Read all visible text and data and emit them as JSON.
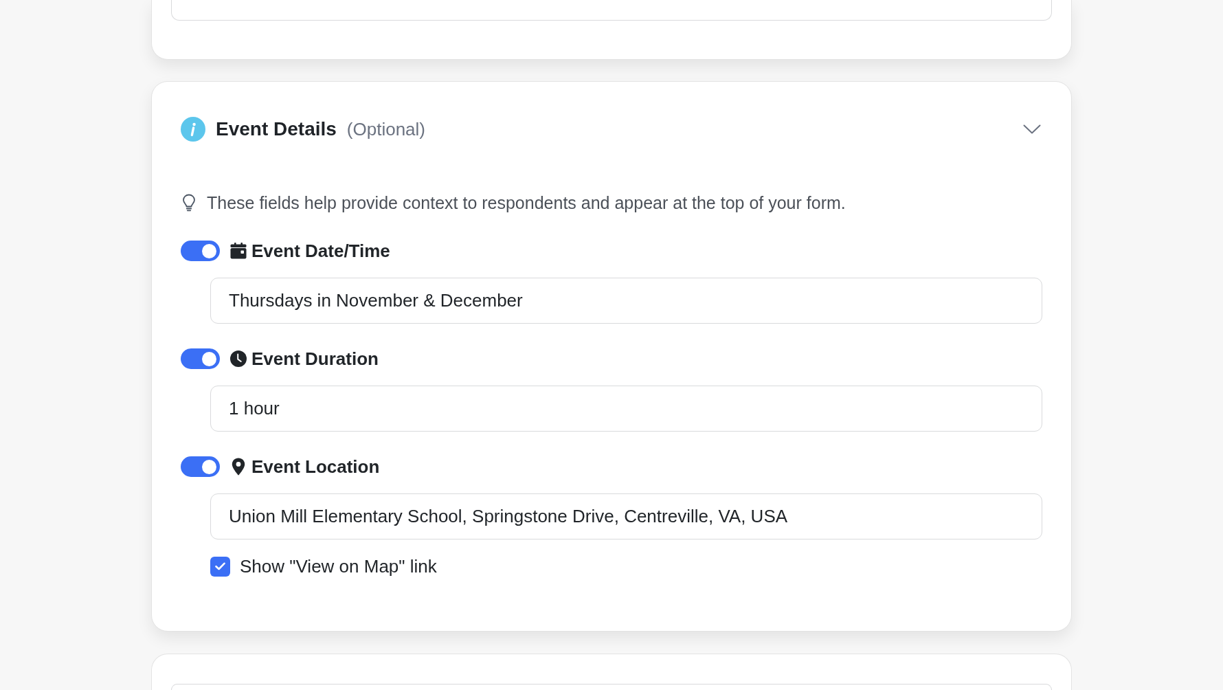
{
  "section": {
    "title": "Event Details",
    "subtitle": "(Optional)",
    "expanded": true,
    "hint": "These fields help provide context to respondents and appear at the top of your form.",
    "fields": [
      {
        "kind": "date",
        "label": "Event Date/Time",
        "on": true,
        "value": "Thursdays in November & December"
      },
      {
        "kind": "duration",
        "label": "Event Duration",
        "on": true,
        "value": "1 hour"
      },
      {
        "kind": "location",
        "label": "Event Location",
        "on": true,
        "value": "Union Mill Elementary School, Springstone Drive, Centreville, VA, USA",
        "option": {
          "label": "Show \"View on Map\" link",
          "checked": true
        }
      }
    ]
  }
}
